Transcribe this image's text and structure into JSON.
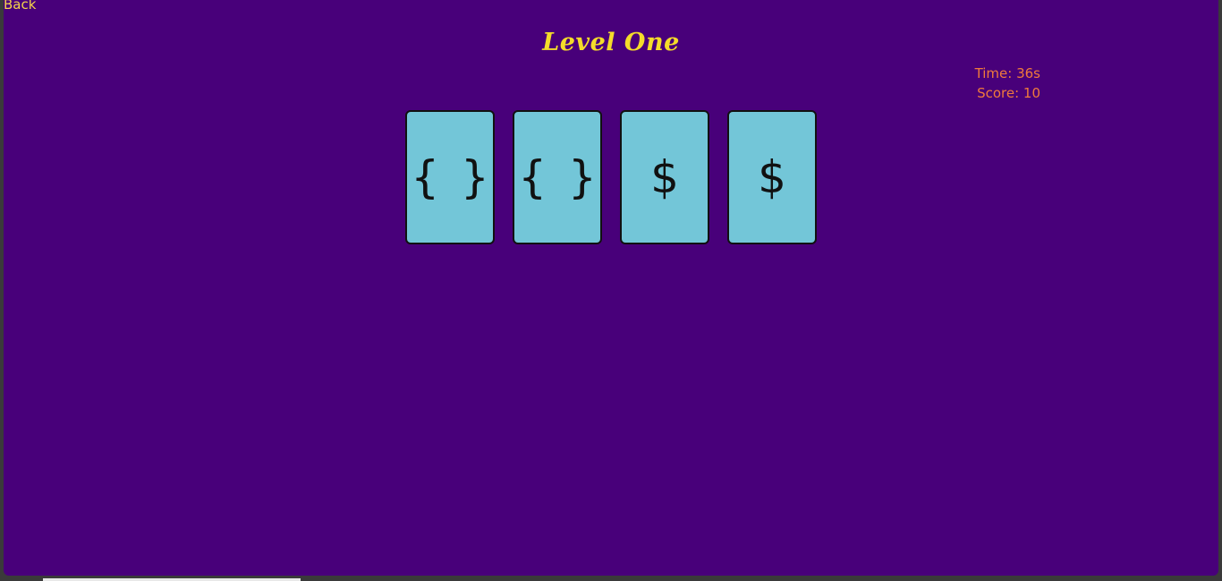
{
  "nav": {
    "back_label": "Back"
  },
  "level": {
    "title": "Level One"
  },
  "stats": {
    "time_label": "Time: 36s",
    "score_label": "Score: 10"
  },
  "cards": [
    {
      "symbol": "{ }",
      "face_up": true
    },
    {
      "symbol": "{ }",
      "face_up": true
    },
    {
      "symbol": "$",
      "face_up": true
    },
    {
      "symbol": "$",
      "face_up": true
    }
  ],
  "colors": {
    "background": "#48007a",
    "title": "#f4dc2a",
    "stats": "#f07a3c",
    "card_face": "#73c6d8",
    "back_link": "#f4d54a"
  }
}
